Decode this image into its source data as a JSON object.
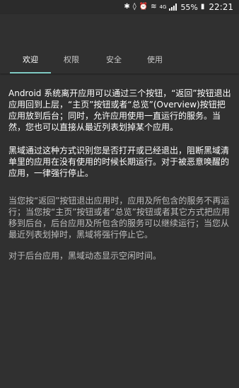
{
  "status_bar": {
    "icons": [
      "bluetooth-icon",
      "mute-icon",
      "alarm-icon",
      "wifi-icon",
      "lte-icon",
      "signal-icon",
      "battery-icon"
    ],
    "network_label": "4G",
    "battery": "55%",
    "time": "22:21"
  },
  "tabs": [
    {
      "label": "欢迎",
      "active": true
    },
    {
      "label": "权限",
      "active": false
    },
    {
      "label": "安全",
      "active": false
    },
    {
      "label": "使用",
      "active": false
    }
  ],
  "colors": {
    "background": "#303030",
    "accent": "#80cbc4",
    "text_primary": "#ffffff",
    "text_secondary": "#bdbdbd"
  },
  "content": {
    "paragraph_1": "Android 系统离开应用可以通过三个按钮，“返回”按钮退出应用回到上层，“主页”按钮或者“总览”(Overview)按钮把应用放到后台；同时，允许应用使用一直运行的服务。当然，您也可以直接从最近列表划掉某个应用。",
    "paragraph_2": "黑域通过这种方式识别您是否打开或已经退出，阻断黑域清单里的应用在没有使用的时候长期运行。对于被恶意唤醒的应用，一律强行停止。",
    "paragraph_3": "当您按“返回”按钮退出应用时，应用及所包含的服务不再运行；当您按“主页”按钮或者“总览”按钮或者其它方式把应用移到后台，后台应用及所包含的服务可以继续运行；当您从最近列表划掉时，黑域将强行停止它。",
    "paragraph_4": "对于后台应用，黑域动态显示空闲时间。"
  }
}
